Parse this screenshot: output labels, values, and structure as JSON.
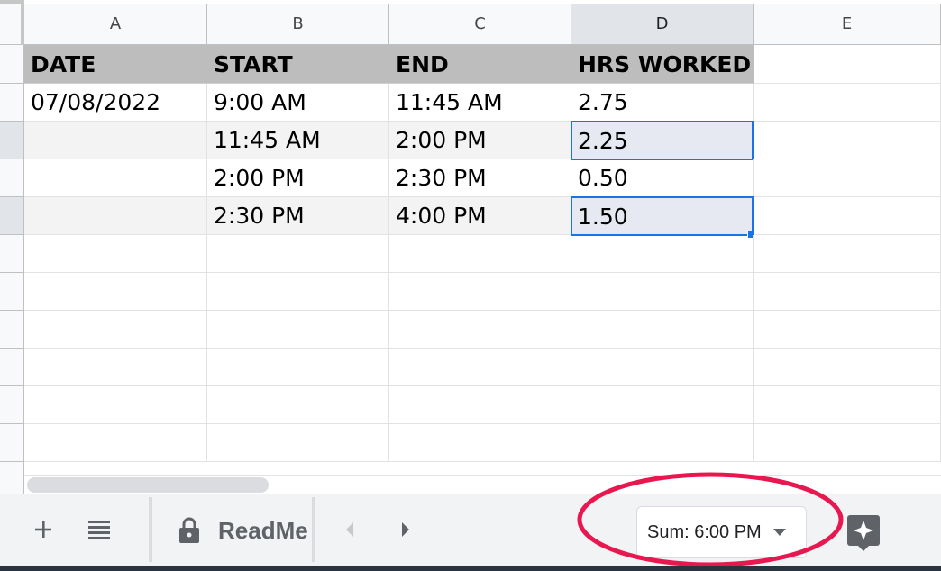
{
  "columns": [
    "A",
    "B",
    "C",
    "D",
    "E"
  ],
  "table": {
    "headers": [
      "DATE",
      "START",
      "END",
      "HRS WORKED"
    ],
    "rows": [
      [
        "07/08/2022",
        "9:00 AM",
        "11:45 AM",
        "2.75"
      ],
      [
        "",
        "11:45 AM",
        "2:00 PM",
        "2.25"
      ],
      [
        "",
        "2:00 PM",
        "2:30 PM",
        "0.50"
      ],
      [
        "",
        "2:30 PM",
        "4:00 PM",
        "1.50"
      ]
    ]
  },
  "footer": {
    "add_sheet_icon": "plus-icon",
    "sheet_list_icon": "list-icon",
    "sheet_tab_label": "ReadMe",
    "sheet_tab_icon": "lock-icon",
    "scroll_left_icon": "chevron-left-icon",
    "scroll_right_icon": "chevron-right-icon",
    "sum_label": "Sum: 6:00 PM",
    "explore_icon": "explore-sparkle-icon"
  },
  "colors": {
    "selection": "#1a73e8",
    "header_fill": "#bdbdbd",
    "annotation": "#e8174f"
  }
}
